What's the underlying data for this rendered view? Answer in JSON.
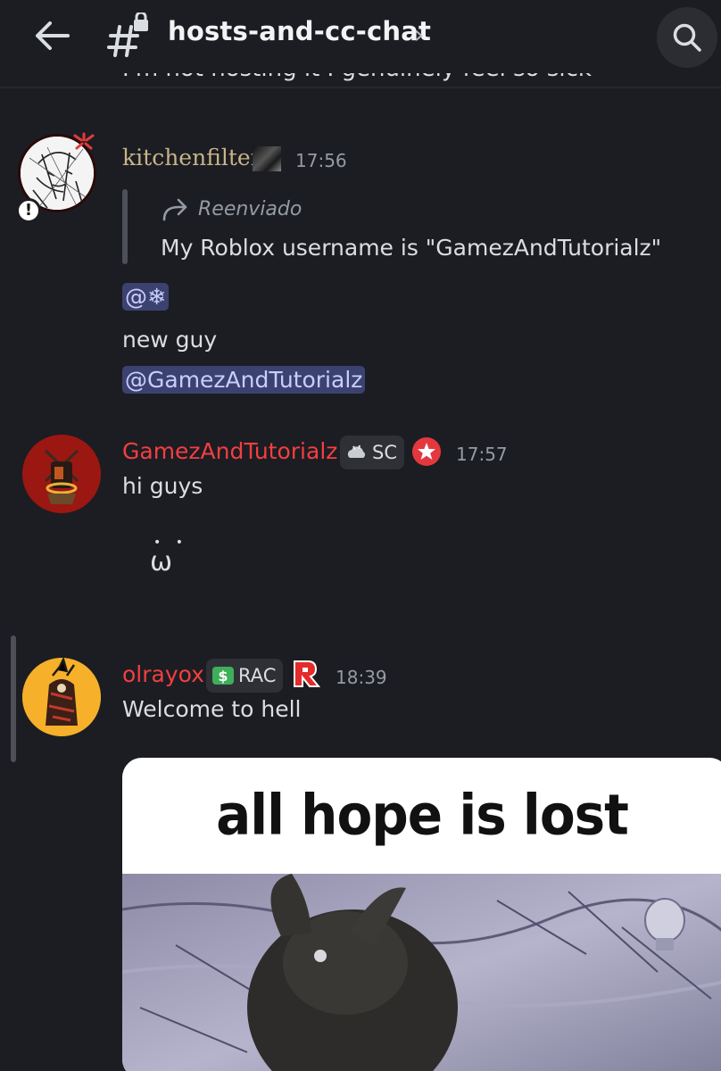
{
  "header": {
    "channel_name": "hosts-and-cc-chat",
    "chevron": "›",
    "back_icon": "arrow-left-icon",
    "channel_icon": "locked-hash-icon",
    "search_icon": "search-icon"
  },
  "partial_message": "I'm not hosting it I genuinely feel so sick",
  "messages": [
    {
      "username": "kitchenfilter",
      "username_color": "#c8b48a",
      "time": "17:56",
      "forwarded_label": "Reenviado",
      "forwarded_text": "My Roblox username is \"GamezAndTutorialz\"",
      "mention_1": "@❄",
      "line": "new guy",
      "mention_2": "@GamezAndTutorialz"
    },
    {
      "username": "GamezAndTutorialz",
      "username_color": "#f23f42",
      "tag_label": "SC",
      "time": "17:57",
      "line_1": "hi guys",
      "emoticon_eyes": "• •",
      "emoticon_mouth": "ω"
    },
    {
      "username": "olrayox",
      "username_color": "#f23f42",
      "tag_label": "RAC",
      "time": "18:39",
      "line_1": "Welcome to hell",
      "image_caption": "all hope is lost"
    }
  ],
  "colors": {
    "background": "#1c1d22",
    "mention_bg": "#3c4270",
    "mention_text": "#c9cdfb",
    "muted": "#949ba4"
  }
}
